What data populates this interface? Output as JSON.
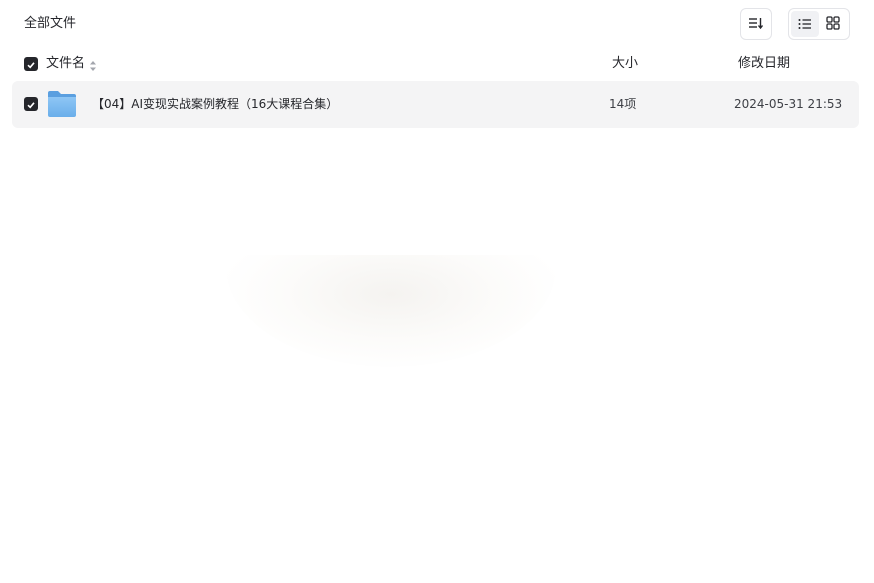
{
  "breadcrumb": {
    "label": "全部文件"
  },
  "toolbar": {
    "sort_icon": "sort-descending-icon",
    "view_list_icon": "list-view-icon",
    "view_grid_icon": "grid-view-icon",
    "active_view": "list"
  },
  "table": {
    "columns": {
      "name": "文件名",
      "size": "大小",
      "date": "修改日期"
    },
    "rows": [
      {
        "icon": "folder-icon",
        "name": "【04】AI变现实战案例教程（16大课程合集）",
        "size": "14项",
        "date": "2024-05-31 21:53",
        "selected": true
      }
    ]
  },
  "colors": {
    "text": "#25262b",
    "row_bg": "#f4f4f5",
    "checkbox": "#25262b",
    "folder": "#7ab8f0"
  }
}
